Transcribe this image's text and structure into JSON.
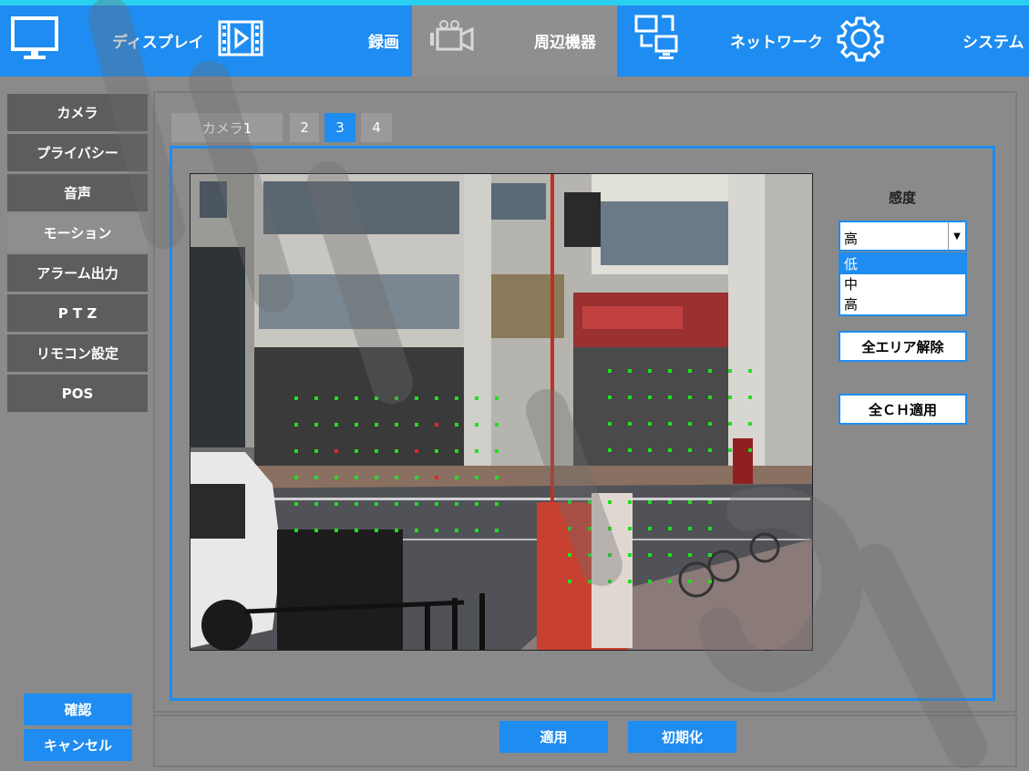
{
  "nav": {
    "display_label": "ディスプレイ",
    "record_label": "録画",
    "peripheral_label": "周辺機器",
    "network_label": "ネットワーク",
    "system_label": "システム",
    "active": "周辺機器"
  },
  "sidebar": {
    "items": [
      {
        "label": "カメラ"
      },
      {
        "label": "プライバシー"
      },
      {
        "label": "音声"
      },
      {
        "label": "モーション",
        "active": true
      },
      {
        "label": "アラーム出力"
      },
      {
        "label": "P T Z"
      },
      {
        "label": "リモコン設定"
      },
      {
        "label": "POS"
      }
    ],
    "confirm_label": "確認",
    "cancel_label": "キャンセル"
  },
  "tabs": [
    {
      "label": "カメラ1"
    },
    {
      "label": "2"
    },
    {
      "label": "3",
      "active": true
    },
    {
      "label": "4"
    }
  ],
  "sensitivity": {
    "label": "感度",
    "selected": "高",
    "options": [
      "低",
      "中",
      "高"
    ],
    "highlighted": "低"
  },
  "actions": {
    "clear_all_label": "全エリア解除",
    "apply_all_ch_label": "全ＣＨ適用"
  },
  "footer": {
    "apply_label": "適用",
    "reset_label": "初期化"
  },
  "colors": {
    "accent": "#1e8cf0",
    "topbar_border": "#2ad0f0",
    "panel_bg": "#8a8a8a",
    "motion_grid": "#22dd22",
    "motion_detected": "#ee2222"
  }
}
